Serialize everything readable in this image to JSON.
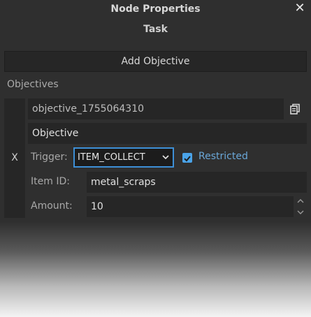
{
  "window": {
    "title": "Node Properties",
    "subtitle": "Task"
  },
  "toolbar": {
    "add_objective_label": "Add Objective"
  },
  "objectives": {
    "section_label": "Objectives",
    "items": [
      {
        "remove_label": "X",
        "id_value": "objective_1755064310",
        "type_value": "Objective",
        "trigger_label": "Trigger:",
        "trigger_value": "ITEM_COLLECT",
        "restricted_label": "Restricted",
        "restricted_checked": true,
        "item_id_label": "Item ID:",
        "item_id_value": "metal_scraps",
        "amount_label": "Amount:",
        "amount_value": "10"
      }
    ]
  },
  "icons": {
    "close": "close-icon",
    "copy": "copy-icon",
    "dropdown": "chevron-down-icon",
    "check": "check-icon",
    "spin_up": "chevron-up-icon",
    "spin_down": "chevron-down-icon"
  },
  "colors": {
    "background": "#2f2f2f",
    "field": "#262626",
    "accent": "#3d8fd6",
    "checkbox": "#4aa3e8",
    "restricted_text": "#6aa7d8"
  }
}
